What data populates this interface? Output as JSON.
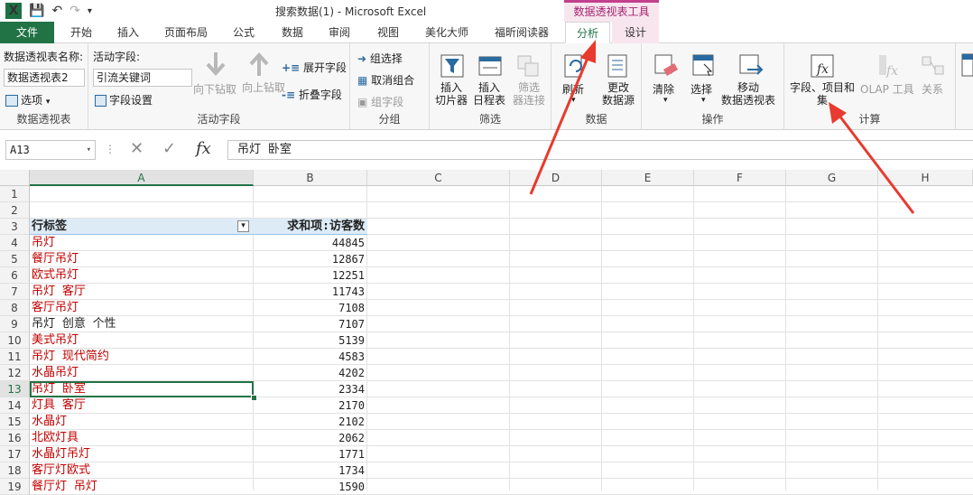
{
  "window": {
    "title": "搜索数据(1) - Microsoft Excel",
    "context_group": "数据透视表工具"
  },
  "tabs": {
    "file": "文件",
    "home": "开始",
    "insert": "插入",
    "layout": "页面布局",
    "formulas": "公式",
    "data": "数据",
    "review": "审阅",
    "view": "视图",
    "meitu": "美化大师",
    "foxit": "福昕阅读器",
    "analyze": "分析",
    "design": "设计"
  },
  "ribbon": {
    "pivot": {
      "name_label": "数据透视表名称:",
      "name_value": "数据透视表2",
      "options": "选项",
      "group": "数据透视表"
    },
    "active_field": {
      "label": "活动字段:",
      "value": "引流关键词",
      "settings": "字段设置",
      "drill_down": "向下钻取",
      "drill_up": "向上钻取",
      "expand": "展开字段",
      "collapse": "折叠字段",
      "group": "活动字段"
    },
    "grouping": {
      "group_selection": "组选择",
      "ungroup": "取消组合",
      "group_field": "组字段",
      "group": "分组"
    },
    "filter": {
      "slicer": "插入\n切片器",
      "timeline": "插入\n日程表",
      "connections": "筛选\n器连接",
      "group": "筛选"
    },
    "data": {
      "refresh": "刷新",
      "change_source": "更改\n数据源",
      "group": "数据"
    },
    "actions": {
      "clear": "清除",
      "select": "选择",
      "move": "移动\n数据透视表",
      "group": "操作"
    },
    "calc": {
      "fields_items": "字段、项目和\n集",
      "olap": "OLAP 工具",
      "relations": "关系",
      "group": "计算"
    }
  },
  "formula_bar": {
    "cell_ref": "A13",
    "formula": "吊灯 卧室"
  },
  "columns": [
    "A",
    "B",
    "C",
    "D",
    "E",
    "F",
    "G",
    "H"
  ],
  "rows": [
    "1",
    "2",
    "3",
    "4",
    "5",
    "6",
    "7",
    "8",
    "9",
    "10",
    "11",
    "12",
    "13",
    "14",
    "15",
    "16",
    "17",
    "18",
    "19"
  ],
  "pivot_table": {
    "header_label": "行标签",
    "header_value": "求和项:访客数",
    "entries": [
      {
        "label": "吊灯",
        "value": "44845",
        "color": "#c00000"
      },
      {
        "label": "餐厅吊灯",
        "value": "12867",
        "color": "#c00000"
      },
      {
        "label": "欧式吊灯",
        "value": "12251",
        "color": "#c00000"
      },
      {
        "label": "吊灯 客厅",
        "value": "11743",
        "color": "#c00000"
      },
      {
        "label": "客厅吊灯",
        "value": "7108",
        "color": "#c00000"
      },
      {
        "label": "吊灯 创意 个性",
        "value": "7107",
        "color": "#222222"
      },
      {
        "label": "美式吊灯",
        "value": "5139",
        "color": "#c00000"
      },
      {
        "label": "吊灯 现代简约",
        "value": "4583",
        "color": "#c00000"
      },
      {
        "label": "水晶吊灯",
        "value": "4202",
        "color": "#c00000"
      },
      {
        "label": "吊灯 卧室",
        "value": "2334",
        "color": "#c00000"
      },
      {
        "label": "灯具 客厅",
        "value": "2170",
        "color": "#c00000"
      },
      {
        "label": "水晶灯",
        "value": "2102",
        "color": "#c00000"
      },
      {
        "label": "北欧灯具",
        "value": "2062",
        "color": "#c00000"
      },
      {
        "label": "水晶灯吊灯",
        "value": "1771",
        "color": "#c00000"
      },
      {
        "label": "客厅灯欧式",
        "value": "1734",
        "color": "#c00000"
      },
      {
        "label": "餐厅灯 吊灯",
        "value": "1590",
        "color": "#c00000"
      }
    ]
  },
  "colors": {
    "excel_green": "#217346",
    "annotation_red": "#e83a2e",
    "context_pink": "#c2418d"
  }
}
